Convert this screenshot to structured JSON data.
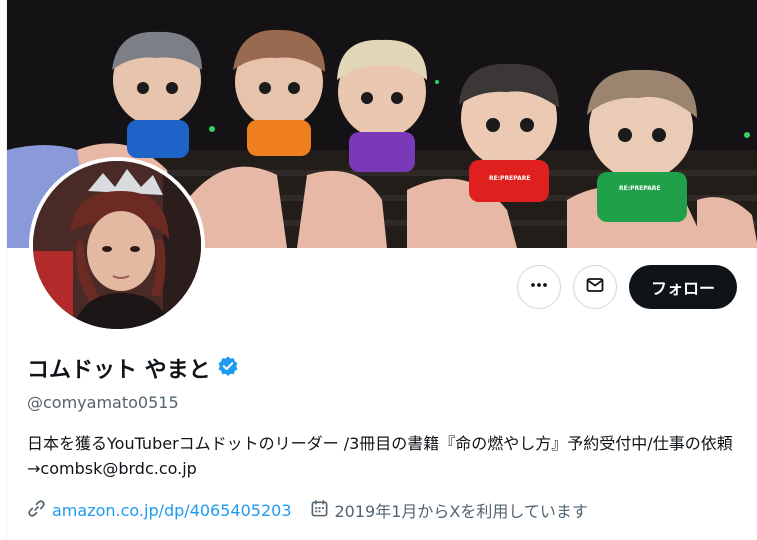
{
  "profile": {
    "display_name": "コムドット やまと",
    "handle": "@comyamato0515",
    "bio": "日本を獲るYouTuberコムドットのリーダー /3冊目の書籍『命の燃やし方』予約受付中/仕事の依頼→combsk@brdc.co.jp",
    "website": "amazon.co.jp/dp/4065405203",
    "joined": "2019年1月からXを利用しています",
    "verified": true
  },
  "actions": {
    "more_icon": "more-horizontal-icon",
    "message_icon": "envelope-icon",
    "follow_label": "フォロー"
  },
  "banner": {
    "shirt_text": "RE:PREPARE"
  },
  "colors": {
    "accent": "#1d9bf0",
    "text": "#0f1419",
    "muted": "#536471",
    "border": "#cfd9de",
    "follow_bg": "#0f1419",
    "plush_shirts": [
      "#1e63c8",
      "#f0801e",
      "#7a3ab8",
      "#e0201e",
      "#21a04a"
    ]
  }
}
